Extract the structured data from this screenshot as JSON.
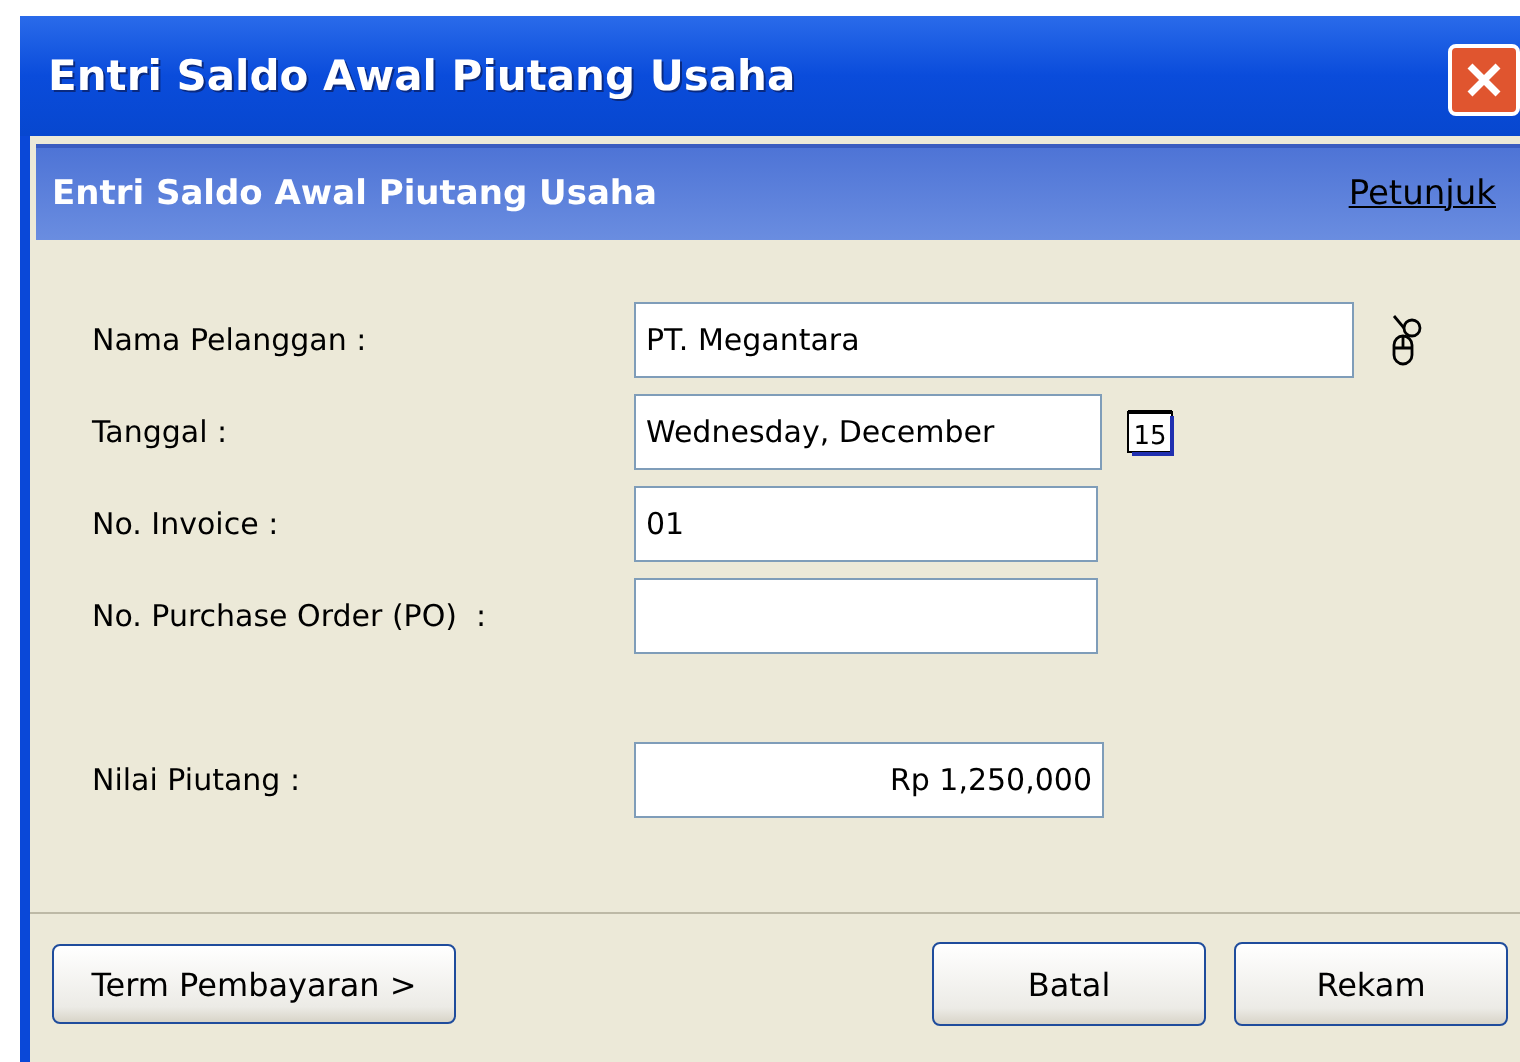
{
  "window": {
    "title": "Entri Saldo Awal Piutang Usaha"
  },
  "header": {
    "title": "Entri Saldo Awal Piutang Usaha",
    "help_link": "Petunjuk"
  },
  "fields": [
    {
      "label": "Nama Pelanggan :",
      "value": "PT. Megantara",
      "kind": "lookup"
    },
    {
      "label": "Tanggal :",
      "value": "Wednesday, December",
      "kind": "date",
      "icon_text": "15"
    },
    {
      "label": "No. Invoice :",
      "value": "01",
      "kind": "text"
    },
    {
      "label": "No. Purchase Order (PO)  :",
      "kind": "text"
    },
    {
      "label": "Nilai Piutang :",
      "value": "Rp 1,250,000",
      "kind": "amount"
    }
  ],
  "buttons": {
    "left": "Term Pembayaran >",
    "cancel": "Batal",
    "save": "Rekam"
  }
}
